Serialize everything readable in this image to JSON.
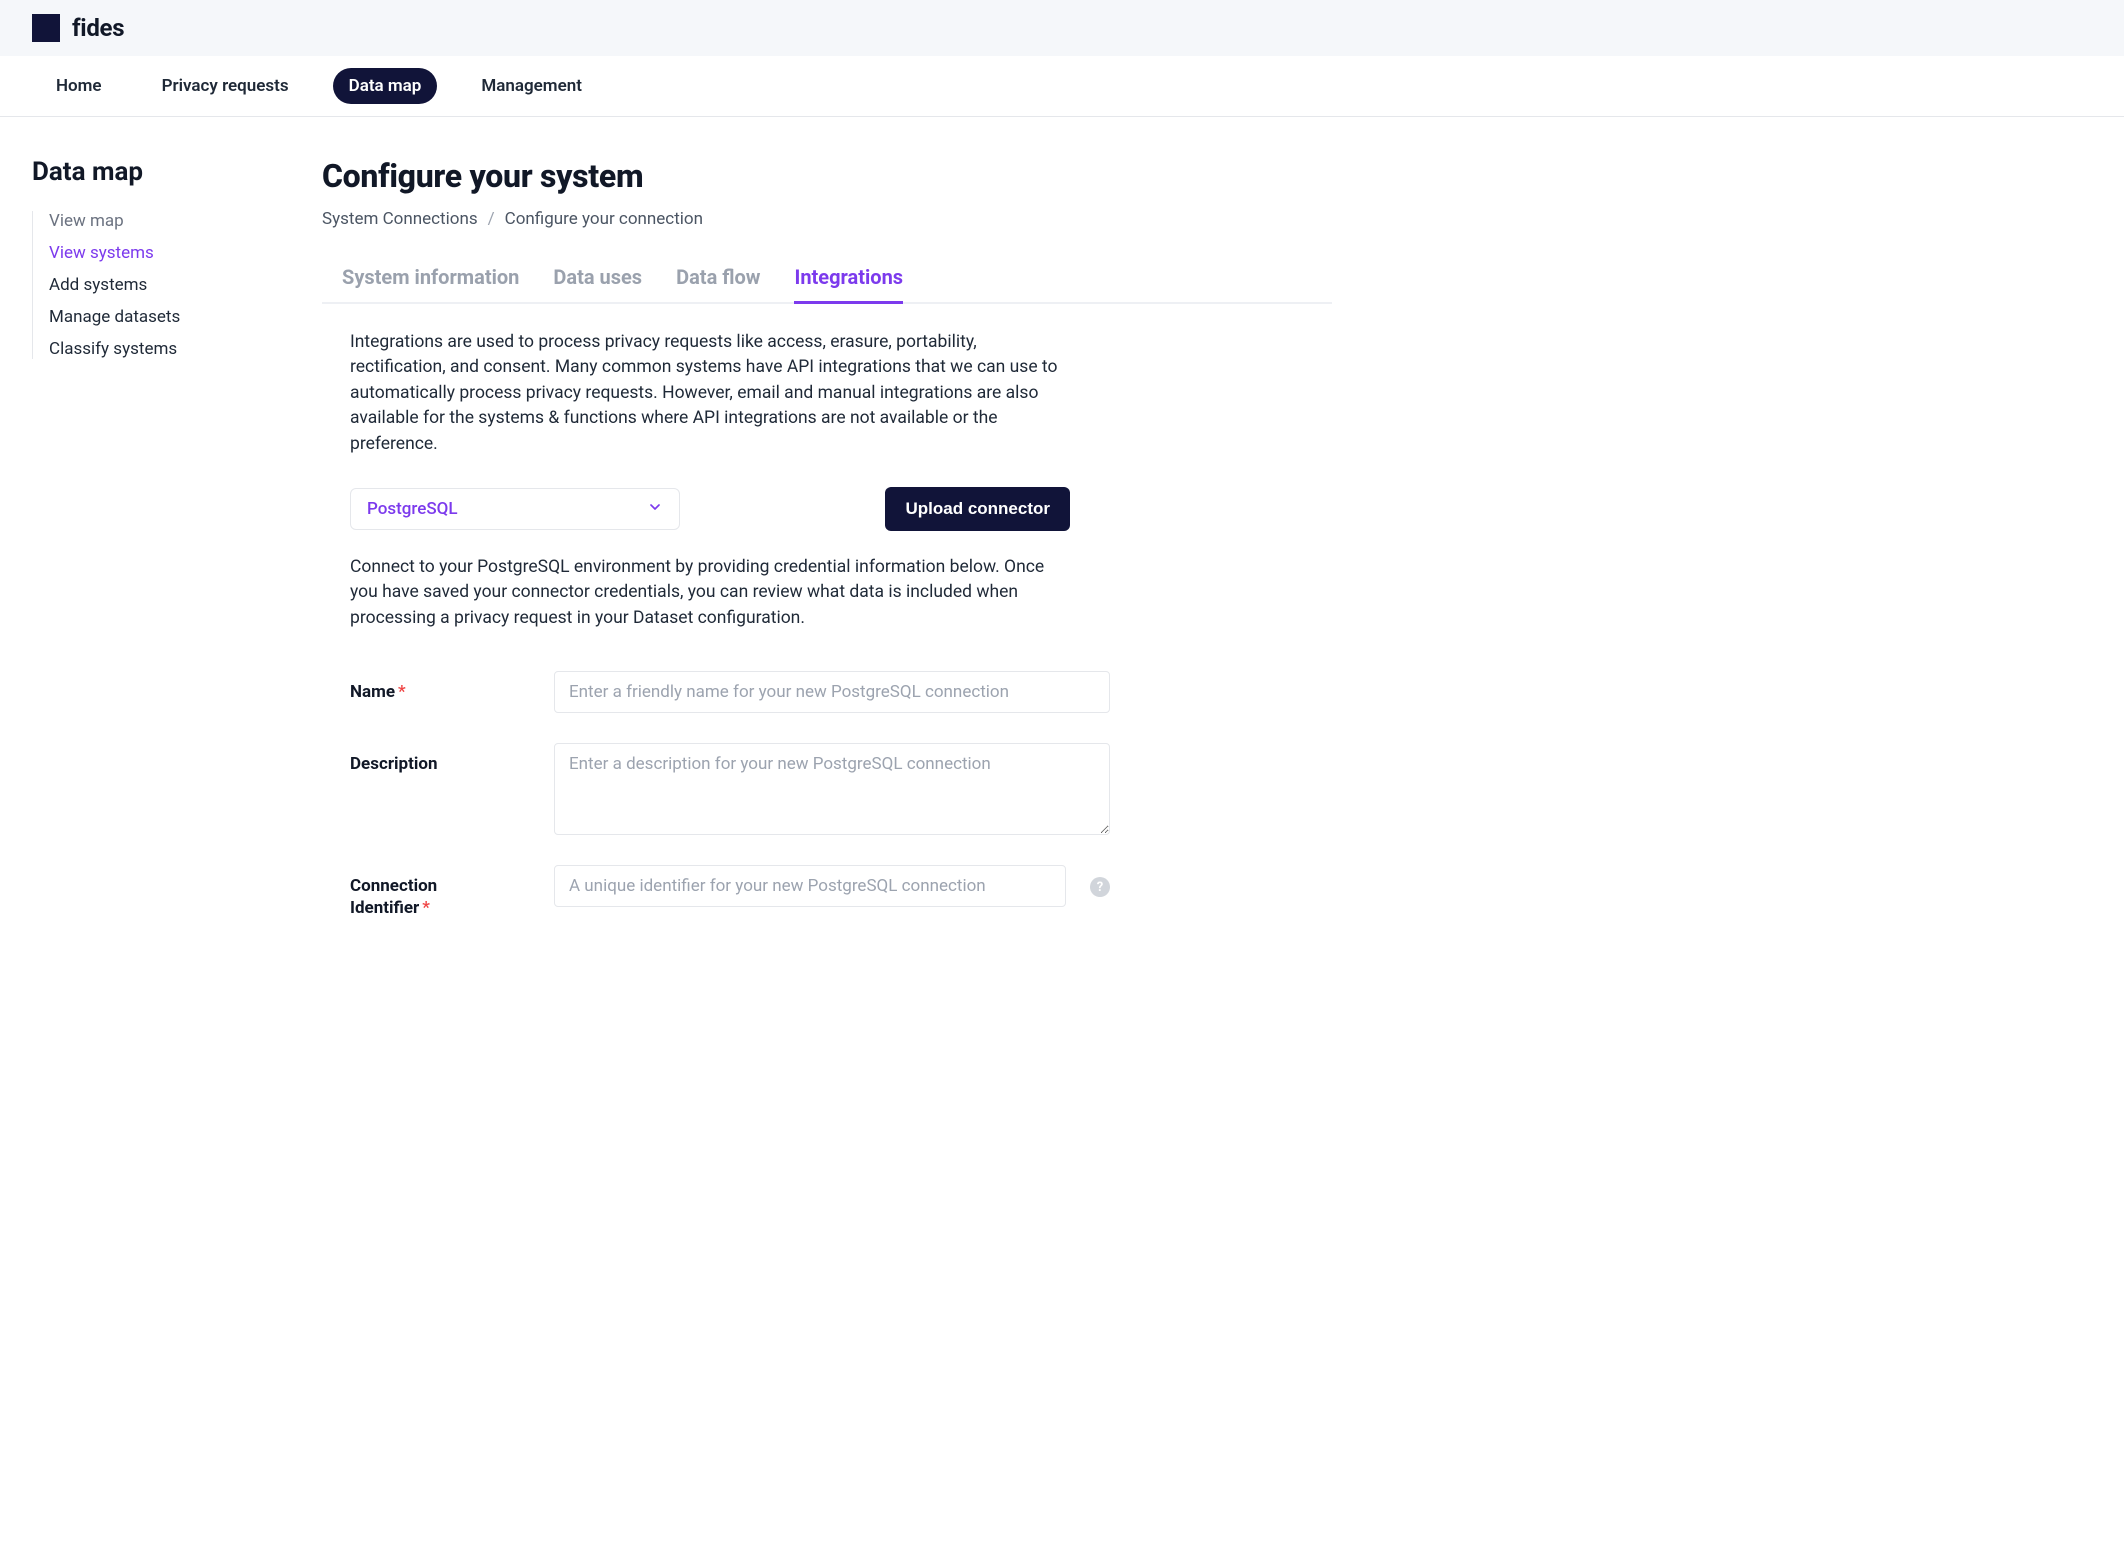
{
  "brand": "fides",
  "nav": {
    "items": [
      {
        "label": "Home"
      },
      {
        "label": "Privacy requests"
      },
      {
        "label": "Data map"
      },
      {
        "label": "Management"
      }
    ],
    "active_index": 2
  },
  "sidebar": {
    "title": "Data map",
    "items": [
      {
        "label": "View map",
        "state": "muted"
      },
      {
        "label": "View systems",
        "state": "active"
      },
      {
        "label": "Add systems",
        "state": ""
      },
      {
        "label": "Manage datasets",
        "state": ""
      },
      {
        "label": "Classify systems",
        "state": ""
      }
    ]
  },
  "page": {
    "title": "Configure your system",
    "breadcrumb": {
      "items": [
        "System Connections",
        "Configure your connection"
      ],
      "sep": "/"
    }
  },
  "tabs": {
    "items": [
      {
        "label": "System information"
      },
      {
        "label": "Data uses"
      },
      {
        "label": "Data flow"
      },
      {
        "label": "Integrations"
      }
    ],
    "active_index": 3
  },
  "integrations": {
    "intro": "Integrations are used to process privacy requests like access, erasure, portability, rectification, and consent. Many common systems have API integrations that we can use to automatically process privacy requests. However, email and manual integrations are also available for the systems & functions where API integrations are not available or the preference.",
    "selector": {
      "value": "PostgreSQL"
    },
    "upload_button": "Upload connector",
    "helper": "Connect to your PostgreSQL environment by providing credential information below. Once you have saved your connector credentials, you can review what data is included when processing a privacy request in your Dataset configuration.",
    "form": {
      "name": {
        "label": "Name",
        "required": "*",
        "placeholder": "Enter a friendly name for your new PostgreSQL connection"
      },
      "description": {
        "label": "Description",
        "placeholder": "Enter a description for your new PostgreSQL connection"
      },
      "connection_identifier": {
        "label_line1": "Connection",
        "label_line2": "Identifier",
        "required": "*",
        "placeholder": "A unique identifier for your new PostgreSQL connection"
      }
    }
  },
  "icons": {
    "help": "?"
  }
}
